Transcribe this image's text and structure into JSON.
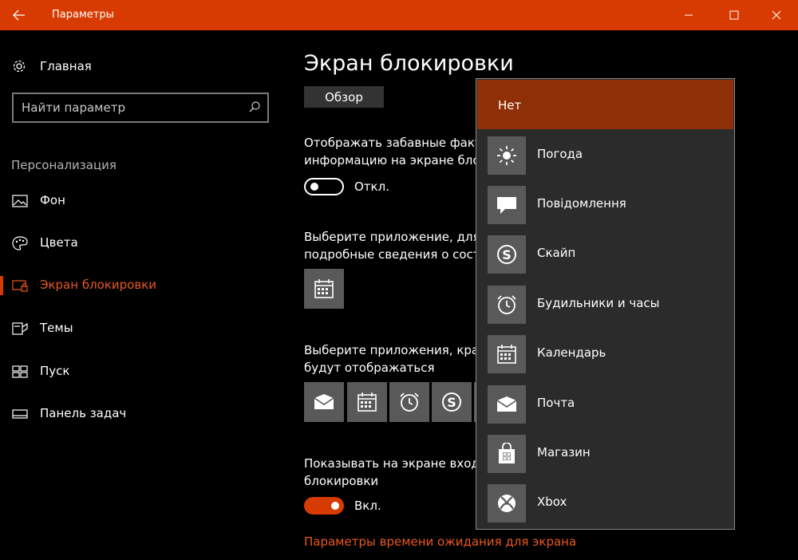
{
  "window": {
    "title": "Параметры"
  },
  "sidebar": {
    "home_label": "Главная",
    "search_placeholder": "Найти параметр",
    "section_header": "Персонализация",
    "items": [
      {
        "label": "Фон",
        "icon": "picture-icon"
      },
      {
        "label": "Цвета",
        "icon": "palette-icon"
      },
      {
        "label": "Экран блокировки",
        "icon": "lock-screen-icon",
        "active": true
      },
      {
        "label": "Темы",
        "icon": "themes-icon"
      },
      {
        "label": "Пуск",
        "icon": "start-icon"
      },
      {
        "label": "Панель задач",
        "icon": "taskbar-icon"
      }
    ]
  },
  "main": {
    "title": "Экран блокировки",
    "browse_label": "Обзор",
    "fun_facts_line1": "Отображать забавные факты",
    "fun_facts_line2": "информацию на экране бло",
    "fun_facts_toggle": "Откл.",
    "detailed_line1": "Выберите приложение, для",
    "detailed_line2": "подробные сведения о сост",
    "quick_line1": "Выберите приложения, крат",
    "quick_line2": "будут отображаться",
    "signin_line1": "Показывать на экране входа",
    "signin_line2": "блокировки",
    "signin_toggle": "Вкл.",
    "timeout_link": "Параметры времени ожидания для экрана"
  },
  "flyout": {
    "none_label": "Нет",
    "items": [
      {
        "label": "Погода",
        "icon": "weather-icon"
      },
      {
        "label": "Повідомлення",
        "icon": "message-icon"
      },
      {
        "label": "Скайп",
        "icon": "skype-icon"
      },
      {
        "label": "Будильники и часы",
        "icon": "alarm-icon"
      },
      {
        "label": "Календарь",
        "icon": "calendar-icon"
      },
      {
        "label": "Почта",
        "icon": "mail-icon"
      },
      {
        "label": "Магазин",
        "icon": "store-icon"
      },
      {
        "label": "Xbox",
        "icon": "xbox-icon"
      }
    ]
  },
  "colors": {
    "accent": "#d83b01",
    "accent_text": "#e8581f",
    "tile": "#595959"
  }
}
